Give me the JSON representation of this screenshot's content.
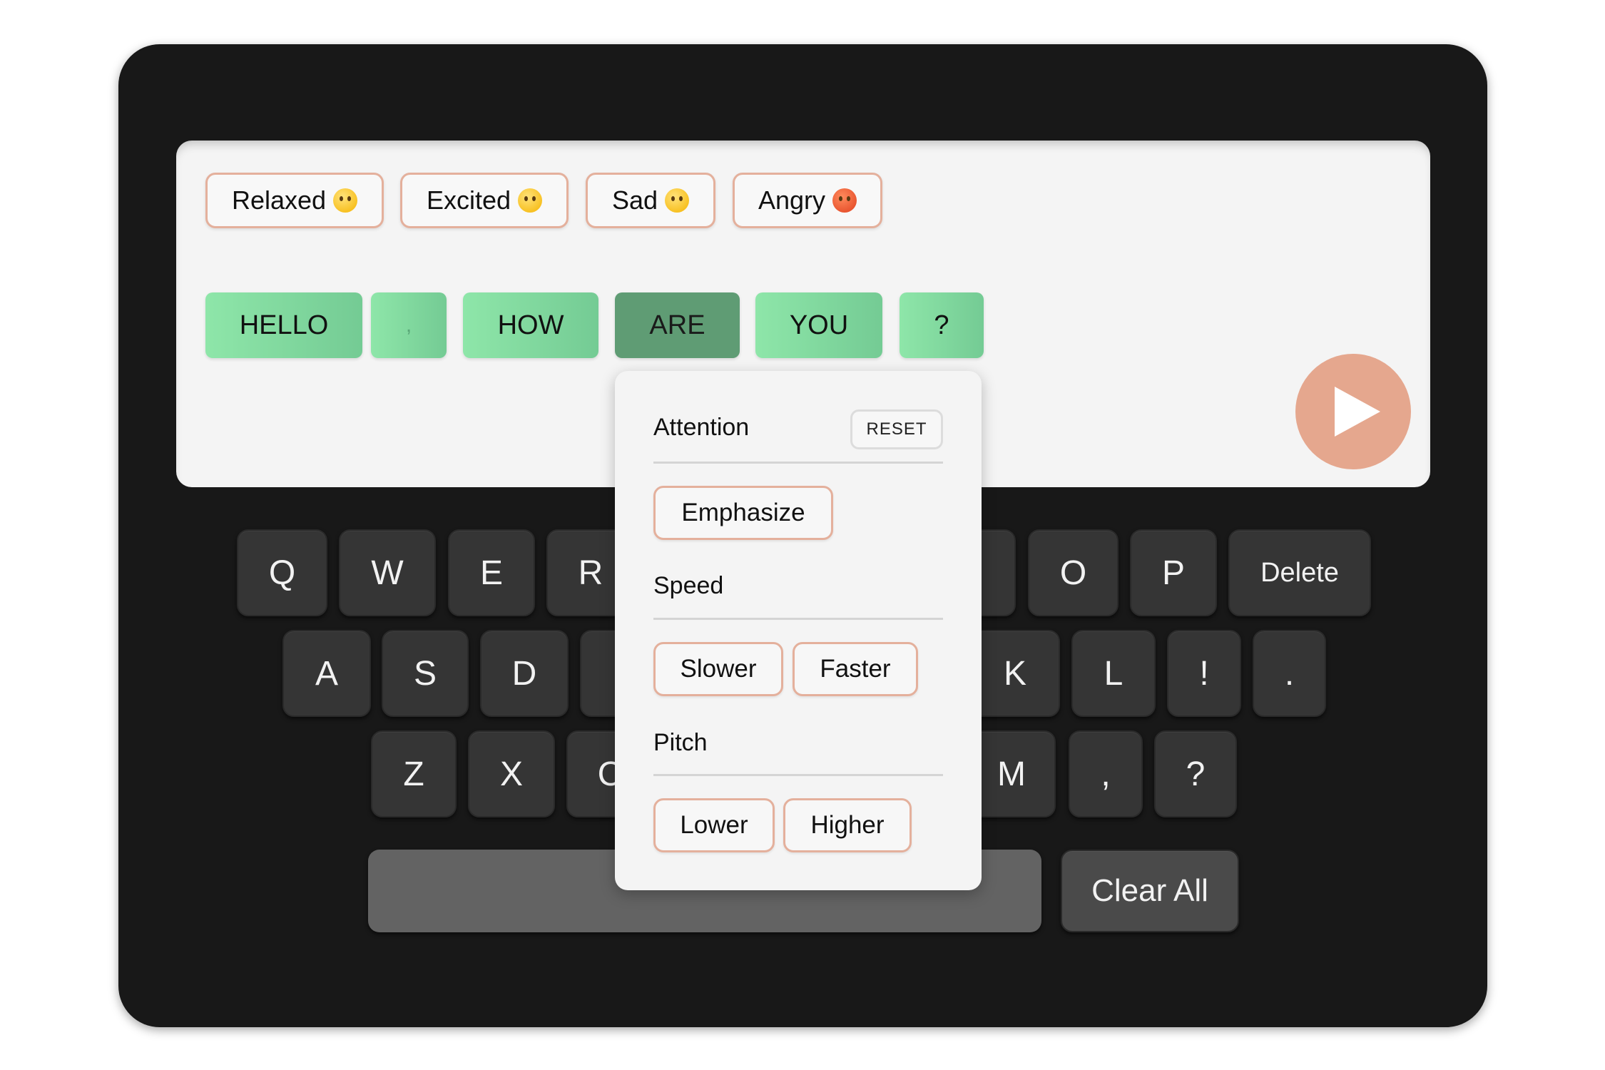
{
  "emotions": [
    {
      "label": "Relaxed",
      "icon": "relieved-face-icon",
      "color": "#f5b400"
    },
    {
      "label": "Excited",
      "icon": "grinning-face-icon",
      "color": "#f5b400"
    },
    {
      "label": "Sad",
      "icon": "pensive-face-icon",
      "color": "#f5b400"
    },
    {
      "label": "Angry",
      "icon": "angry-face-icon",
      "color": "#e0411f"
    }
  ],
  "sentence": {
    "words": [
      "HELLO",
      ",",
      "HOW",
      "ARE",
      "YOU",
      "?"
    ],
    "selected_index": 3
  },
  "play_button": {
    "icon": "play-icon",
    "color": "#e5a78e"
  },
  "popup": {
    "attention": {
      "title": "Attention",
      "reset_label": "RESET",
      "emphasize_label": "Emphasize"
    },
    "speed": {
      "title": "Speed",
      "slower_label": "Slower",
      "faster_label": "Faster"
    },
    "pitch": {
      "title": "Pitch",
      "lower_label": "Lower",
      "higher_label": "Higher"
    }
  },
  "keyboard": {
    "row1": [
      "Q",
      "W",
      "E",
      "R",
      "O",
      "P",
      "Delete"
    ],
    "row2": [
      "A",
      "S",
      "D",
      "K",
      "L",
      "!",
      "."
    ],
    "row3": [
      "Z",
      "X",
      "C",
      "M",
      ",",
      "?"
    ],
    "clear_label": "Clear All"
  },
  "colors": {
    "word_tile": "#8ee6a9",
    "word_tile_selected": "#5f9c74",
    "accent_border": "#e4b09c",
    "device_body": "#181818"
  }
}
